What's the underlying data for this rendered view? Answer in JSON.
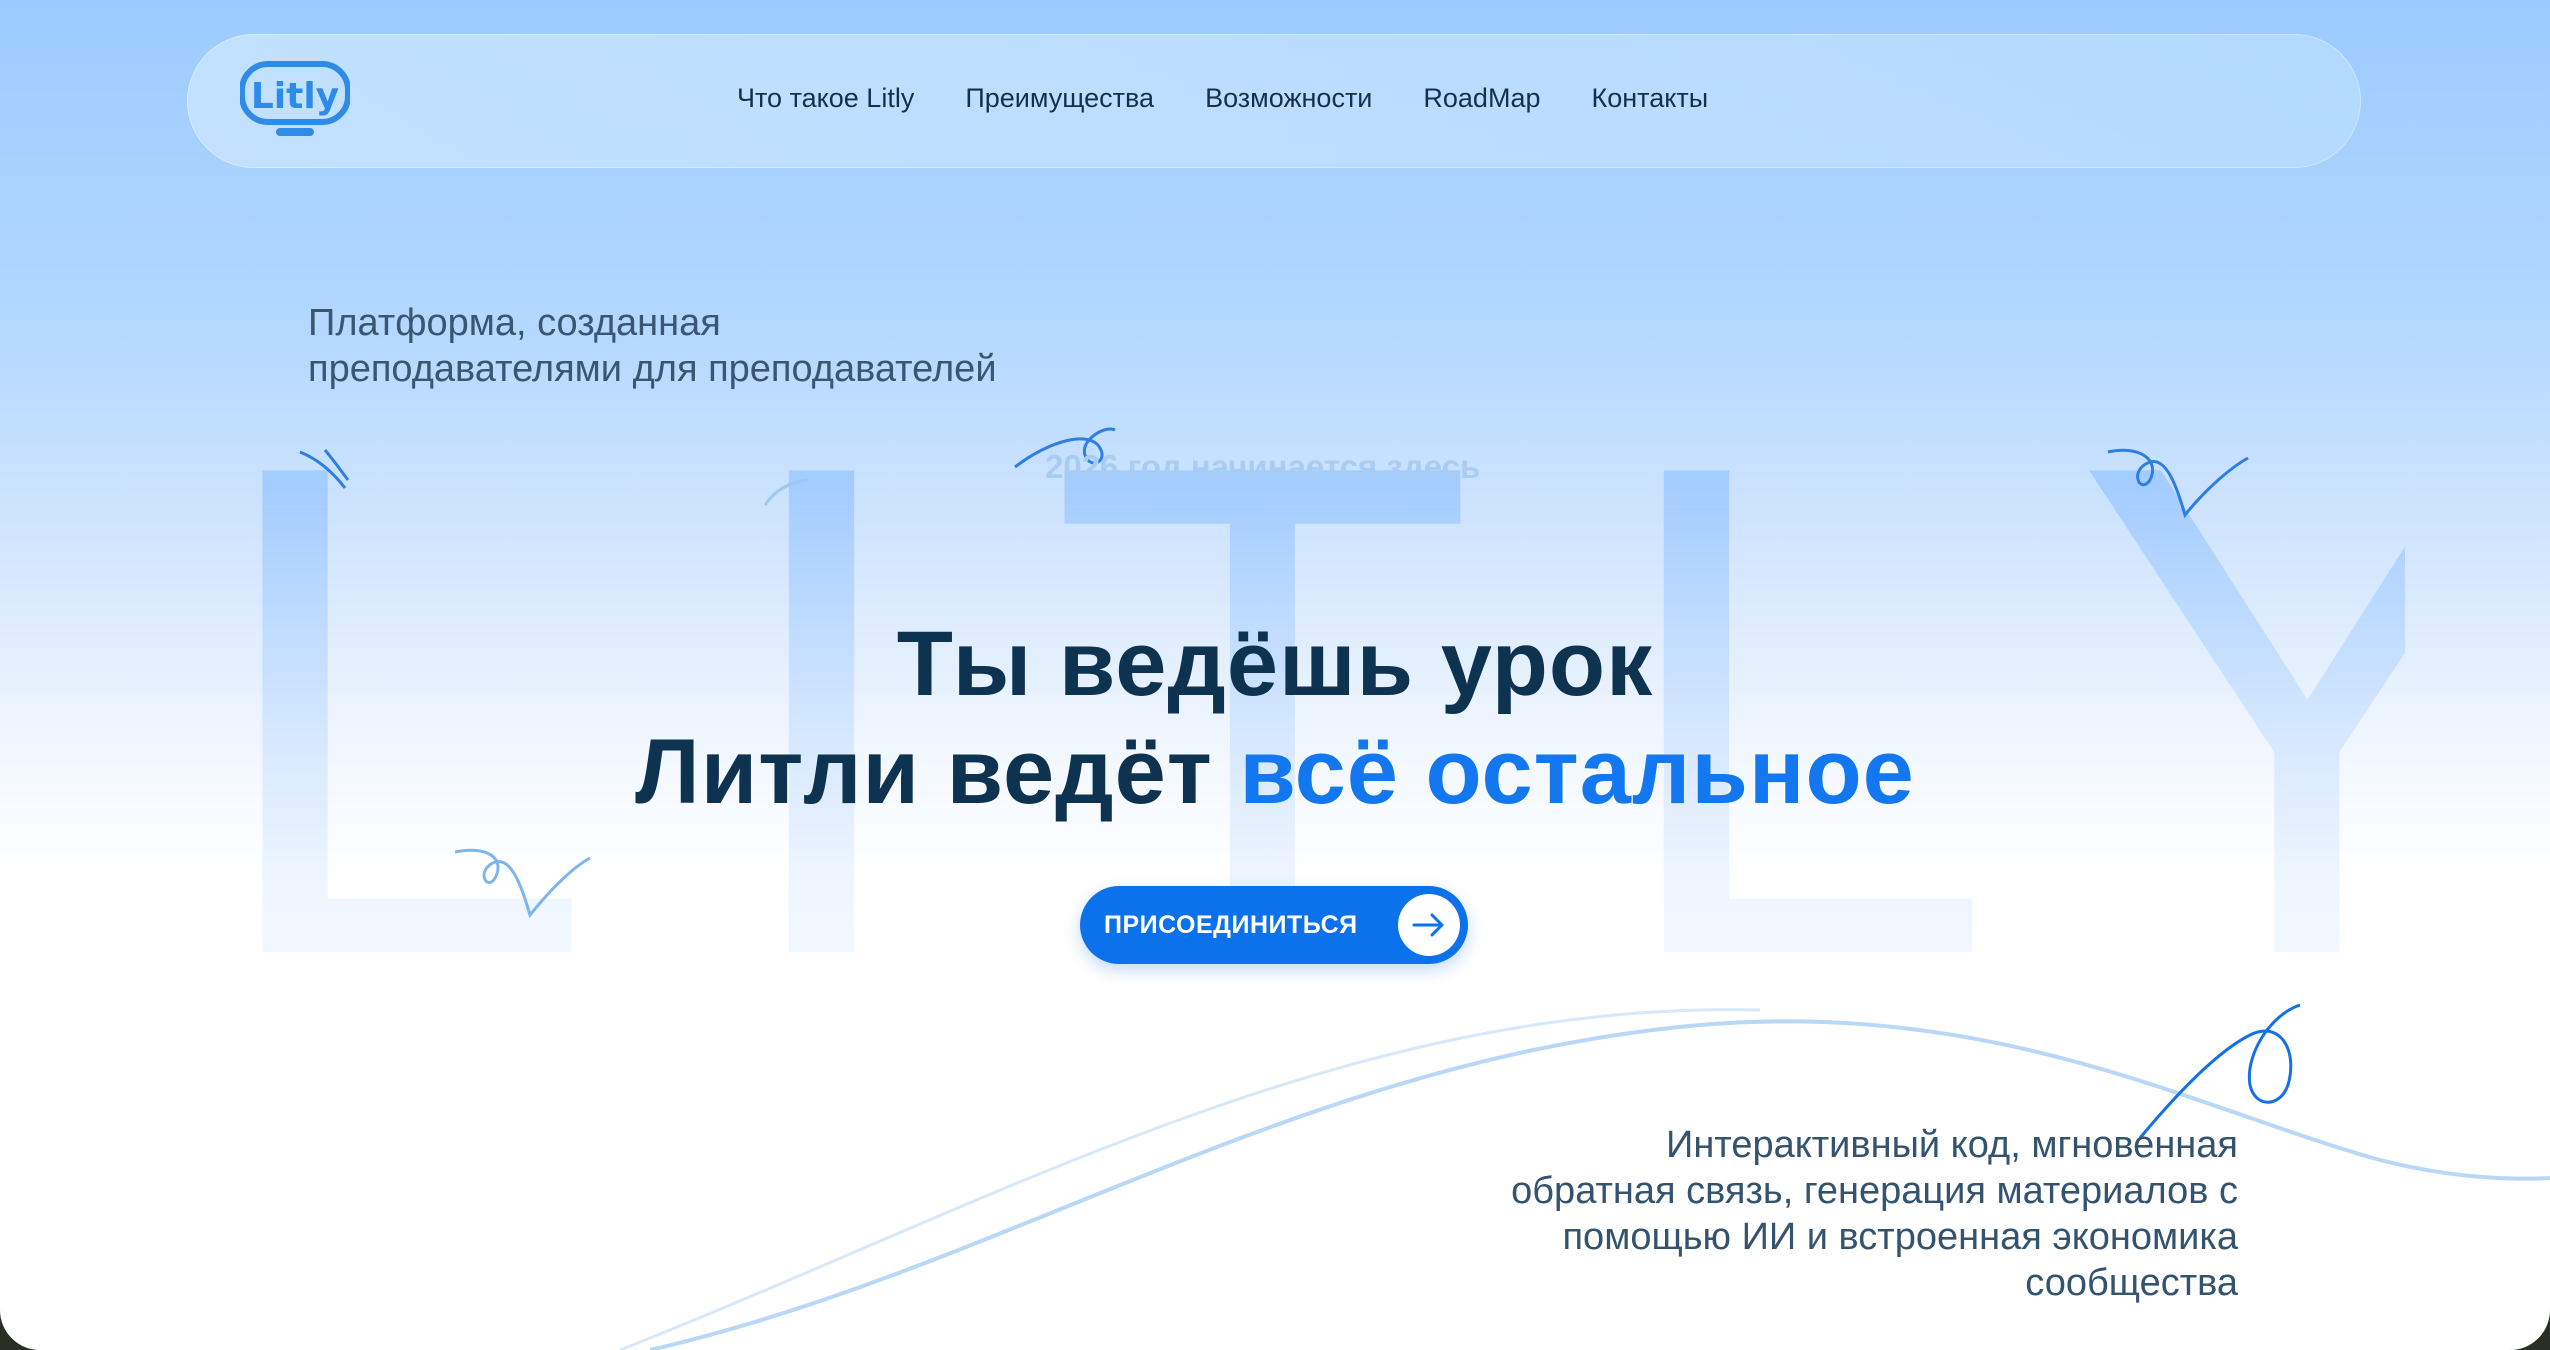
{
  "brand": {
    "logo_text": "Litly",
    "colors": {
      "accent": "#1378f0",
      "dark_text": "#0e3350",
      "button": "#0c72ec",
      "background_top": "#9ccaff"
    }
  },
  "nav": {
    "items": [
      {
        "label": "Что такое Litly"
      },
      {
        "label": "Преимущества"
      },
      {
        "label": "Возможности"
      },
      {
        "label": "RoadMap"
      },
      {
        "label": "Контакты"
      }
    ]
  },
  "hero": {
    "background_word": "LITLY",
    "tagline_lines": [
      "Платформа, созданная",
      "преподавателями для преподавателей"
    ],
    "year_note": "2026 год начинается здесь",
    "title_line1": "Ты ведёшь урок",
    "title_line2_prefix": "Литли ведёт ",
    "title_line2_accent": "всё остальное",
    "cta_label": "ПРИСОЕДИНИТЬСЯ",
    "cta_icon": "arrow-right-icon",
    "description_lines": [
      "Интерактивный код, мгновенная",
      "обратная связь, генерация материалов с",
      "помощью ИИ и встроенная экономика",
      "сообщества"
    ]
  }
}
